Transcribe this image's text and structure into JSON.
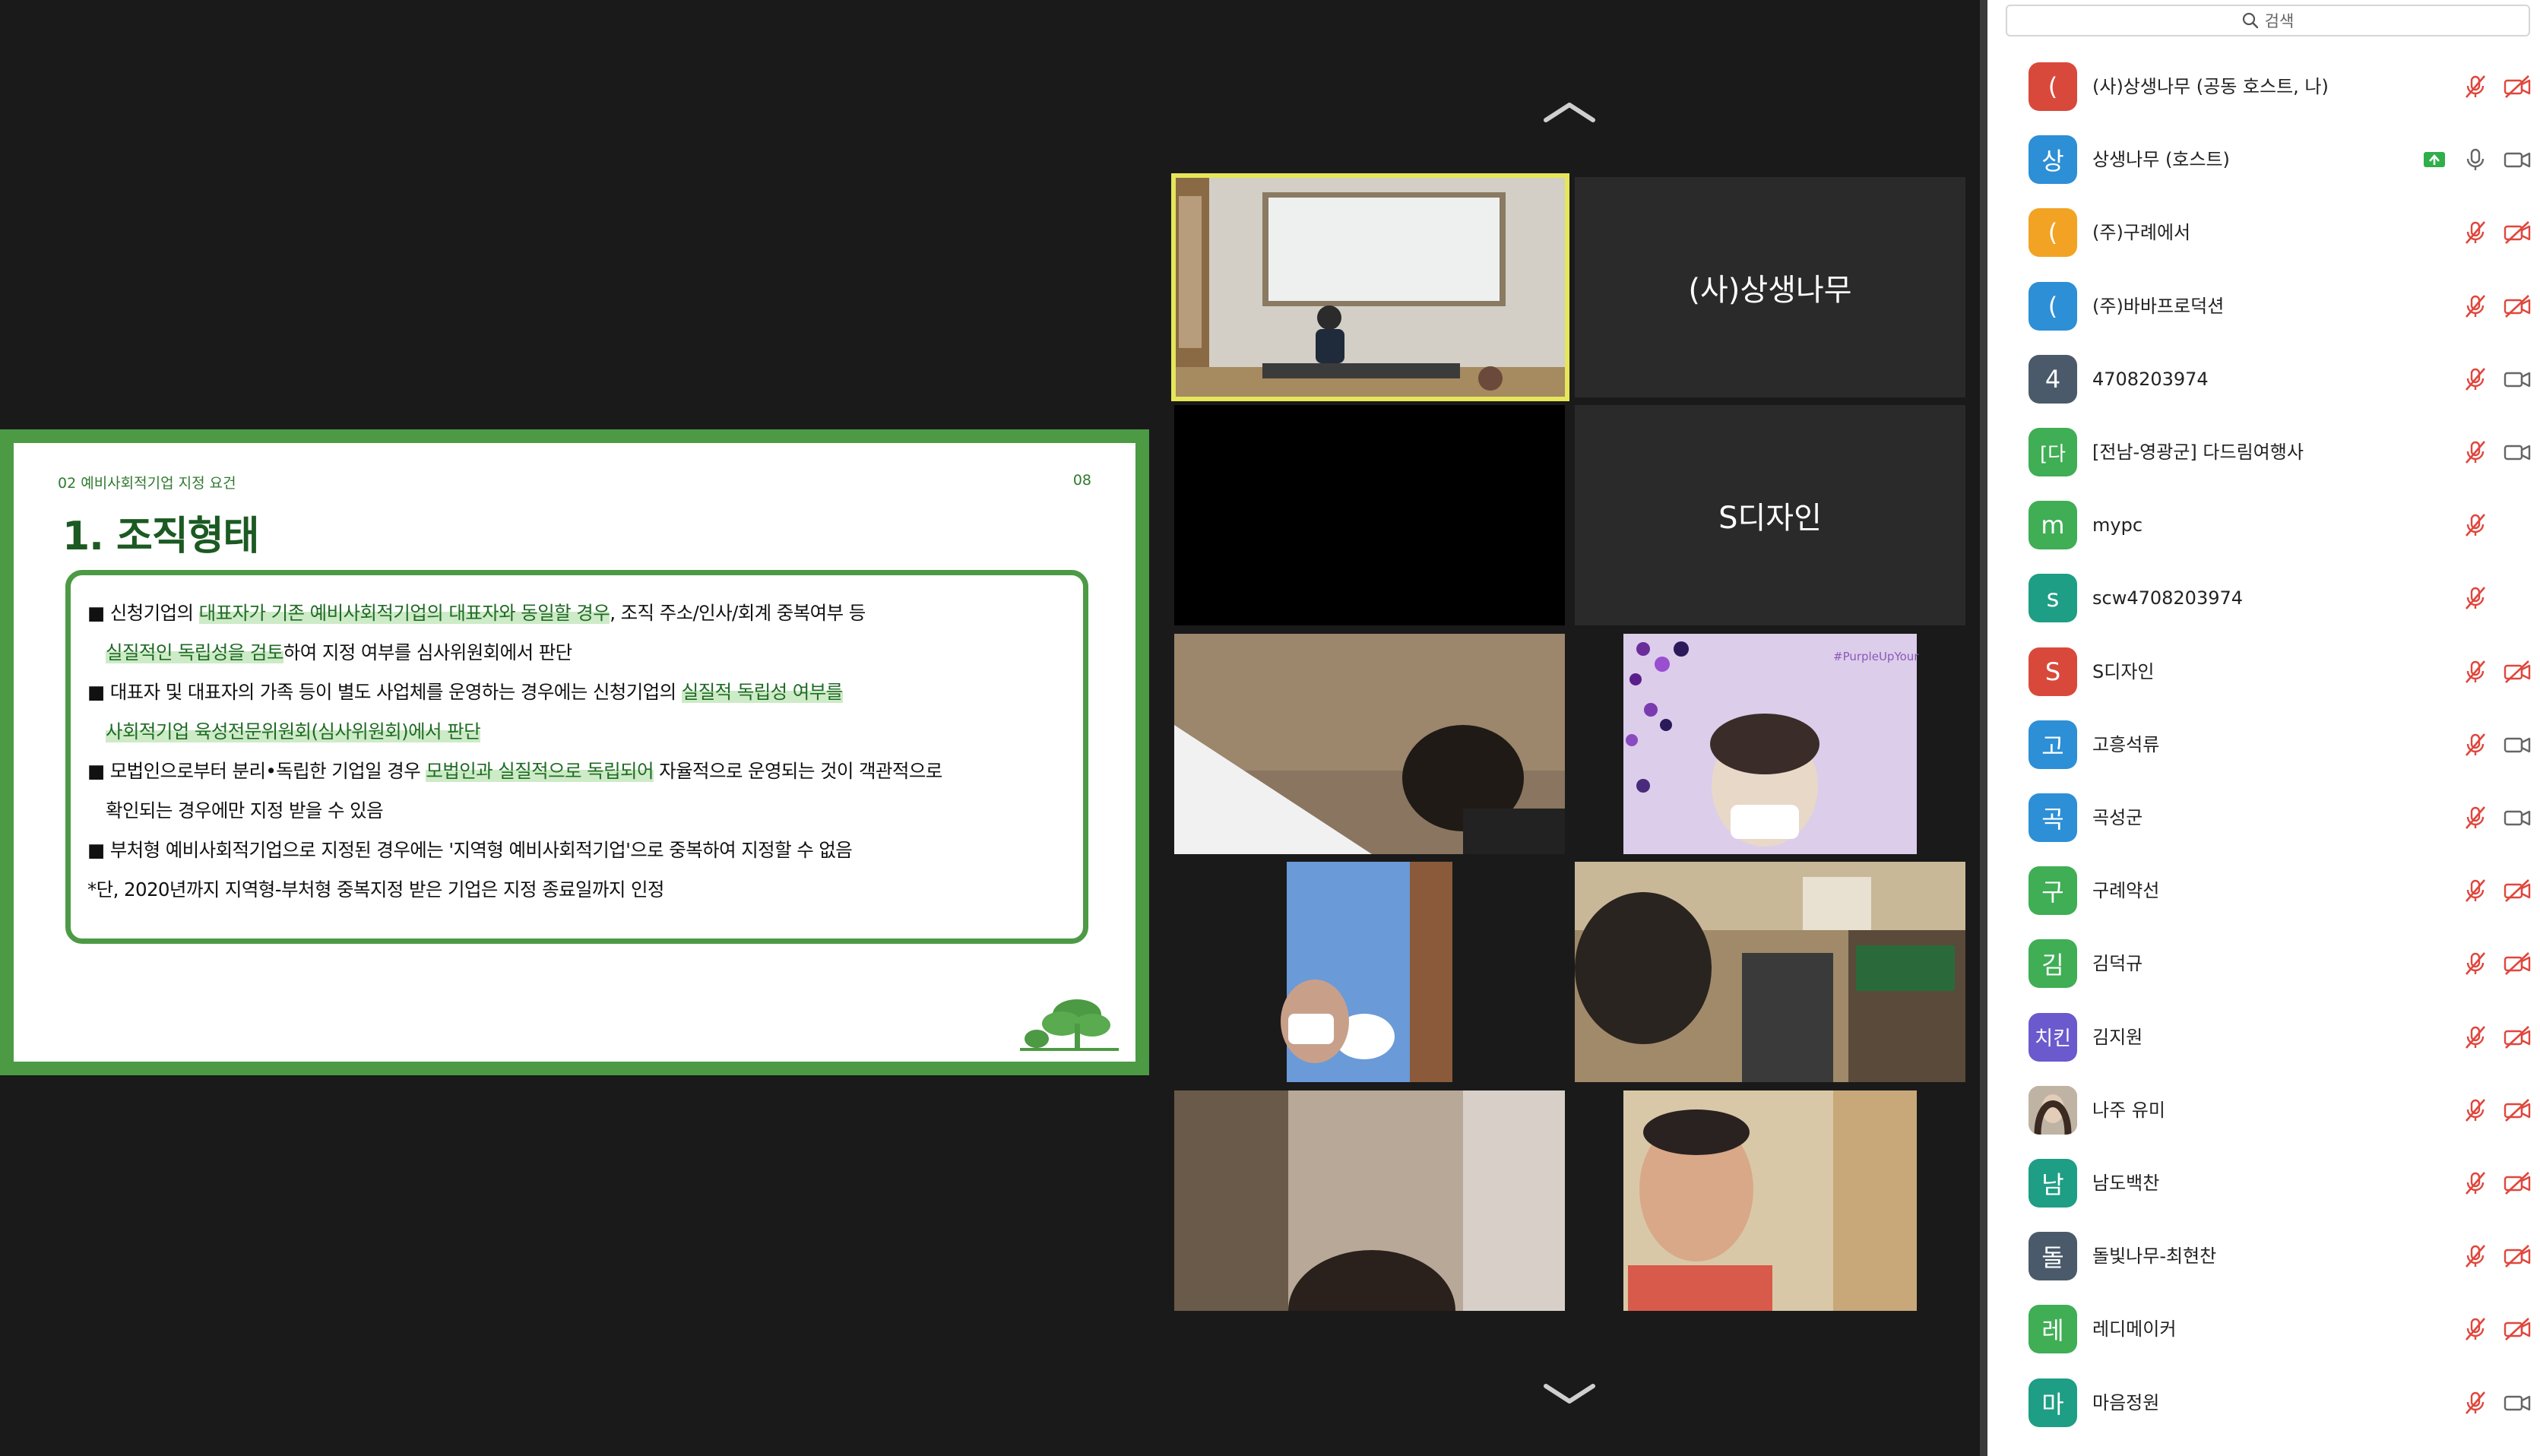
{
  "slide": {
    "section": "02 예비사회적기업 지정 요건",
    "page": "08",
    "title": "1. 조직형태",
    "lines": [
      {
        "pre": "■ 신청기업의 ",
        "hl": "대표자가 기존 예비사회적기업의 대표자와 동일할 경우",
        "post": ", 조직 주소/인사/회계 중복여부 등"
      },
      {
        "pre": "",
        "hl": "실질적인 독립성을 검토",
        "post": "하여 지정 여부를 심사위원회에서 판단"
      },
      {
        "pre": "■ 대표자 및 대표자의 가족 등이 별도 사업체를 운영하는 경우에는 신청기업의 ",
        "hl": "실질적 독립성 여부를",
        "post": ""
      },
      {
        "pre": "",
        "hl": "사회적기업 육성전문위원회(심사위원회)에서 판단",
        "post": ""
      },
      {
        "pre": "■ 모법인으로부터 분리•독립한 기업일 경우 ",
        "hl": "모법인과 실질적으로 독립되어",
        "post": " 자율적으로 운영되는 것이 객관적으로"
      },
      {
        "pre": "확인되는 경우에만 지정 받을 수 있음",
        "hl": "",
        "post": ""
      },
      {
        "pre": "■ 부처형 예비사회적기업으로 지정된 경우에는 '지역형 예비사회적기업'으로 중복하여 지정할 수 없음",
        "hl": "",
        "post": ""
      },
      {
        "pre": "*단, 2020년까지 지역형-부처형 중복지정 받은 기업은 지정 종료일까지 인정",
        "hl": "",
        "post": ""
      }
    ]
  },
  "tiles": {
    "name1": "(사)상생나무",
    "name2": "S디자인",
    "banner": "#PurpleUpYour"
  },
  "panel": {
    "search_placeholder": "검색",
    "participants": [
      {
        "initial": "(",
        "color": "#d9493b",
        "name": "(사)상생나무 (공동 호스트, 나)",
        "mic": "muted",
        "cam": "off"
      },
      {
        "initial": "상",
        "color": "#2d8fd6",
        "name": "상생나무 (호스트)",
        "mic": "on",
        "cam": "on",
        "share": true
      },
      {
        "initial": "(",
        "color": "#f2a324",
        "name": "(주)구례에서",
        "mic": "muted",
        "cam": "off"
      },
      {
        "initial": "(",
        "color": "#2d8fd6",
        "name": "(주)바바프로덕션",
        "mic": "muted",
        "cam": "off"
      },
      {
        "initial": "4",
        "color": "#4a5a6a",
        "name": "4708203974",
        "mic": "muted",
        "cam": "on"
      },
      {
        "initial": "[다",
        "color": "#3fae55",
        "name": "[전남-영광군] 다드림여행사",
        "mic": "muted",
        "cam": "on"
      },
      {
        "initial": "m",
        "color": "#3fae55",
        "name": "mypc",
        "mic": "muted",
        "cam": "none"
      },
      {
        "initial": "s",
        "color": "#1e9e84",
        "name": "scw4708203974",
        "mic": "muted",
        "cam": "none"
      },
      {
        "initial": "S",
        "color": "#d9493b",
        "name": "S디자인",
        "mic": "muted",
        "cam": "off"
      },
      {
        "initial": "고",
        "color": "#2d8fd6",
        "name": "고흥석류",
        "mic": "muted",
        "cam": "on"
      },
      {
        "initial": "곡",
        "color": "#2d8fd6",
        "name": "곡성군",
        "mic": "muted",
        "cam": "on"
      },
      {
        "initial": "구",
        "color": "#3fae55",
        "name": "구례약선",
        "mic": "muted",
        "cam": "off"
      },
      {
        "initial": "김",
        "color": "#3fae55",
        "name": "김덕규",
        "mic": "muted",
        "cam": "off"
      },
      {
        "initial": "치킨",
        "color": "#6a5acd",
        "name": "김지원",
        "mic": "muted",
        "cam": "off"
      },
      {
        "initial": "",
        "color": "#9a8878",
        "name": "나주 유미",
        "mic": "muted",
        "cam": "off",
        "photo": true
      },
      {
        "initial": "남",
        "color": "#1e9e84",
        "name": "남도백찬",
        "mic": "muted",
        "cam": "off"
      },
      {
        "initial": "돌",
        "color": "#4a5a6a",
        "name": "돌빛나무-최현찬",
        "mic": "muted",
        "cam": "off"
      },
      {
        "initial": "레",
        "color": "#3fae55",
        "name": "레디메이커",
        "mic": "muted",
        "cam": "off"
      },
      {
        "initial": "마",
        "color": "#1e9e84",
        "name": "마음정원",
        "mic": "muted",
        "cam": "on"
      }
    ]
  }
}
